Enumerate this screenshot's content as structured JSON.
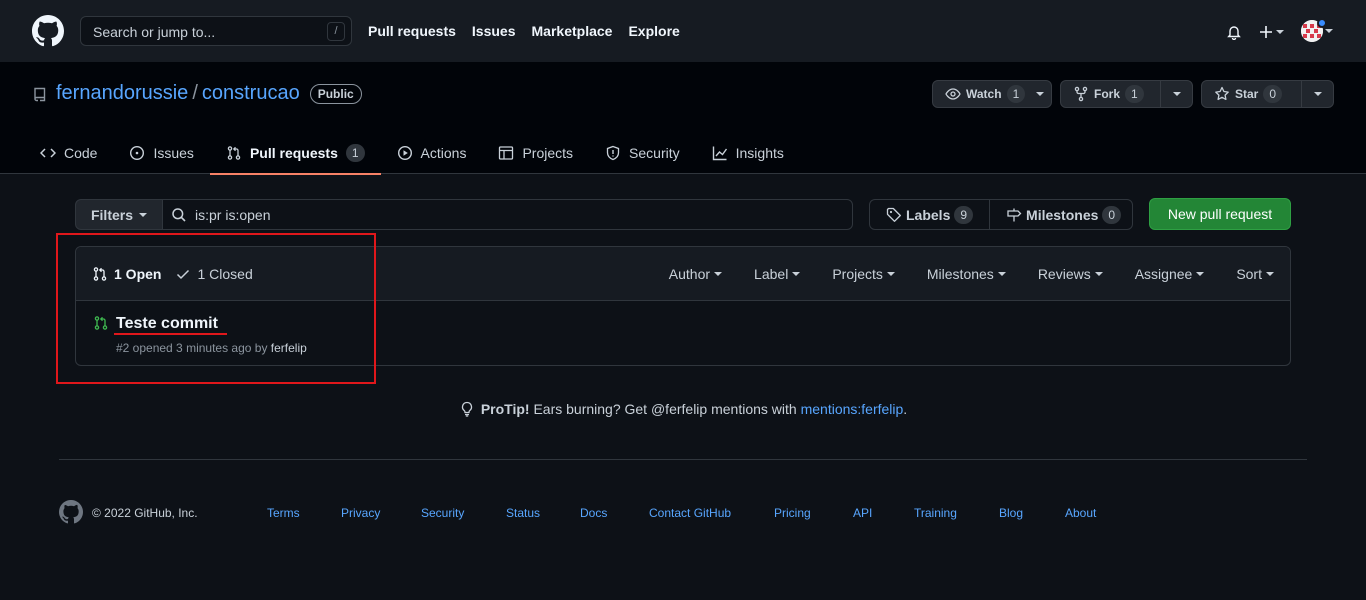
{
  "header": {
    "search_placeholder": "Search or jump to...",
    "search_shortcut": "/",
    "nav": [
      "Pull requests",
      "Issues",
      "Marketplace",
      "Explore"
    ]
  },
  "repo": {
    "owner": "fernandorussie",
    "separator": "/",
    "name": "construcao",
    "visibility": "Public",
    "watch": {
      "label": "Watch",
      "count": "1"
    },
    "fork": {
      "label": "Fork",
      "count": "1"
    },
    "star": {
      "label": "Star",
      "count": "0"
    },
    "tabs": [
      {
        "label": "Code",
        "icon": "code-icon"
      },
      {
        "label": "Issues",
        "icon": "issue-icon"
      },
      {
        "label": "Pull requests",
        "icon": "pull-request-icon",
        "count": "1",
        "selected": true
      },
      {
        "label": "Actions",
        "icon": "play-icon"
      },
      {
        "label": "Projects",
        "icon": "table-icon"
      },
      {
        "label": "Security",
        "icon": "shield-icon"
      },
      {
        "label": "Insights",
        "icon": "graph-icon"
      }
    ]
  },
  "subnav": {
    "filters_label": "Filters",
    "query": "is:pr is:open",
    "labels": {
      "label": "Labels",
      "count": "9"
    },
    "milestones": {
      "label": "Milestones",
      "count": "0"
    },
    "new_pr_label": "New pull request"
  },
  "list": {
    "open_label": "1 Open",
    "closed_label": "1 Closed",
    "sorters": [
      "Author",
      "Label",
      "Projects",
      "Milestones",
      "Reviews",
      "Assignee",
      "Sort"
    ],
    "items": [
      {
        "title": "Teste commit",
        "meta_prefix": "#2 opened 3 minutes ago by",
        "author": "ferfelip"
      }
    ]
  },
  "protip": {
    "bold": "ProTip!",
    "text": " Ears burning? Get @ferfelip mentions with ",
    "link": "mentions:ferfelip",
    "end": "."
  },
  "footer": {
    "copyright": "© 2022 GitHub, Inc.",
    "links": [
      "Terms",
      "Privacy",
      "Security",
      "Status",
      "Docs",
      "Contact GitHub",
      "Pricing",
      "API",
      "Training",
      "Blog",
      "About"
    ]
  },
  "colors": {
    "accent_link": "#58a6ff",
    "selected_tab_underline": "#f78166",
    "primary_button": "#238636",
    "annotation": "#e0171b",
    "open_pr_icon": "#3fb950"
  }
}
